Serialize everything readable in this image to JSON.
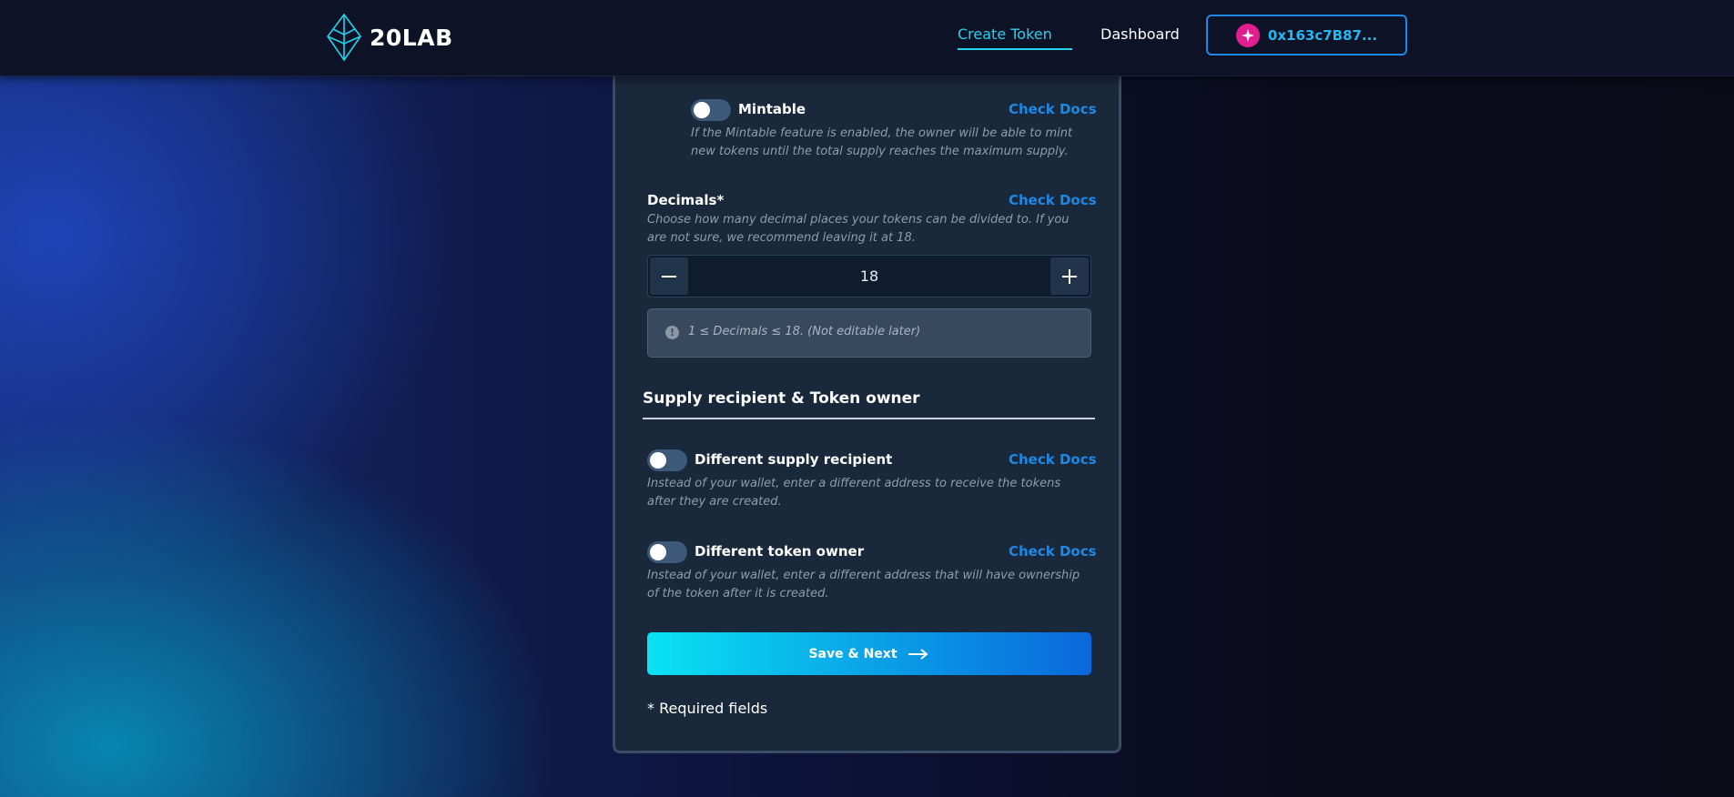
{
  "header": {
    "brand": "20LAB",
    "nav": {
      "create_token": "Create Token",
      "dashboard": "Dashboard"
    },
    "wallet": {
      "address": "0x163c7B87..."
    }
  },
  "form": {
    "mintable": {
      "label": "Mintable",
      "docs": "Check Docs",
      "help": "If the Mintable feature is enabled, the owner will be able to mint new tokens until the total supply reaches the maximum supply.",
      "enabled": false
    },
    "decimals": {
      "label": "Decimals*",
      "docs": "Check Docs",
      "help": "Choose how many decimal places your tokens can be divided to. If you are not sure, we recommend leaving it at 18.",
      "value": "18",
      "note": "1 ≤ Decimals ≤ 18. (Not editable later)"
    },
    "section_title": "Supply recipient & Token owner",
    "different_supply_recipient": {
      "label": "Different supply recipient",
      "docs": "Check Docs",
      "help": "Instead of your wallet, enter a different address to receive the tokens after they are created.",
      "enabled": false
    },
    "different_token_owner": {
      "label": "Different token owner",
      "docs": "Check Docs",
      "help": "Instead of your wallet, enter a different address that will have ownership of the token after it is created.",
      "enabled": false
    },
    "save_button": "Save & Next",
    "required_note": "* Required fields"
  },
  "colors": {
    "accent": "#22d3ee",
    "link": "#1e88e5",
    "card_bg": "#1a283c",
    "wallet_avatar": "#e11d8f"
  },
  "icons": [
    "20lab-logo-icon",
    "wallet-avatar-icon",
    "minus-icon",
    "plus-icon",
    "info-icon",
    "arrow-right-icon"
  ]
}
